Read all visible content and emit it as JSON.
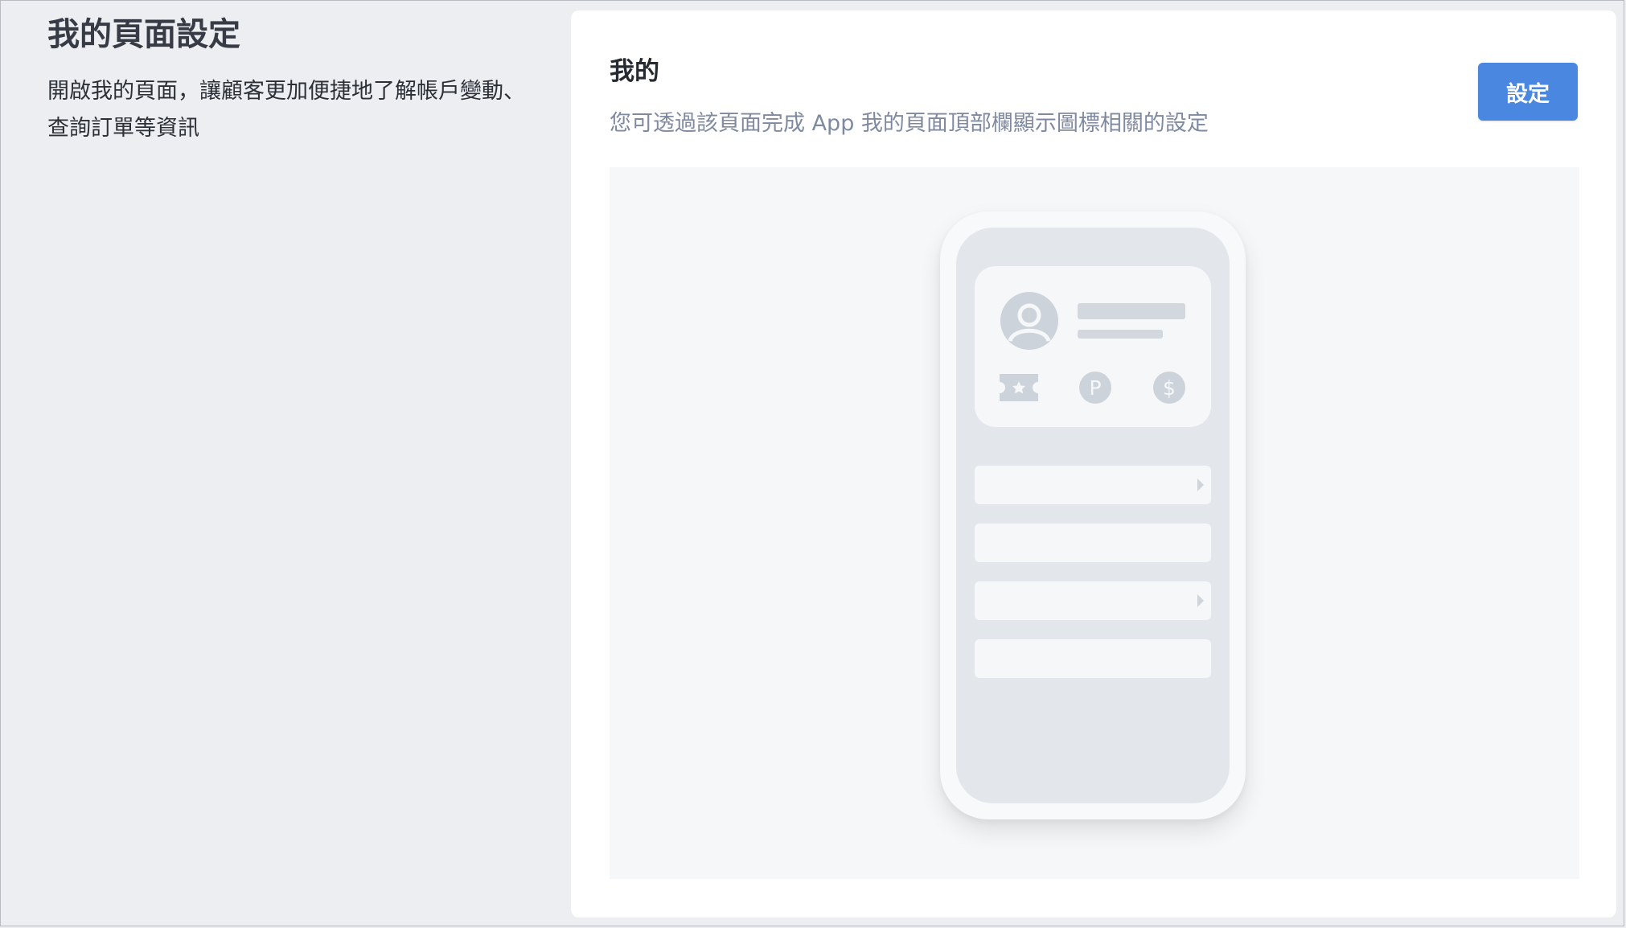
{
  "page": {
    "title": "我的頁面設定",
    "description": "開啟我的頁面，讓顧客更加便捷地了解帳戶變動、查詢訂單等資訊"
  },
  "card": {
    "title": "我的",
    "description": "您可透過該頁面完成 App 我的頁面頂部欄顯示圖標相關的設定",
    "button_label": "設定"
  },
  "preview": {
    "icons": [
      "avatar-icon",
      "ticket-star-icon",
      "points-p-icon",
      "dollar-icon"
    ],
    "rows": [
      {
        "has_arrow": true
      },
      {
        "has_arrow": false
      },
      {
        "has_arrow": true
      },
      {
        "has_arrow": false
      }
    ]
  },
  "colors": {
    "accent": "#4a87e0",
    "page_bg": "#eceef1",
    "card_bg": "#ffffff",
    "muted_text": "#7f8aa0"
  }
}
